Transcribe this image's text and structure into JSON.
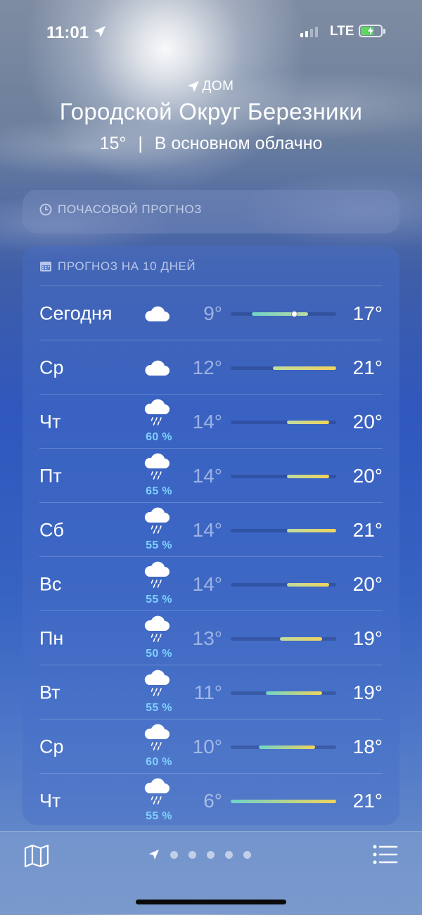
{
  "status_bar": {
    "time": "11:01",
    "network": "LTE",
    "battery_color": "#5fd65f"
  },
  "header": {
    "location_label": "ДОМ",
    "city": "Городской Округ Березники",
    "current_temp": "15°",
    "separator": "|",
    "condition": "В основном облачно"
  },
  "hourly": {
    "title": "ПОЧАСОВОЙ ПРОГНОЗ",
    "icon": "clock-icon"
  },
  "daily": {
    "title": "ПРОГНОЗ НА 10 ДНЕЙ",
    "icon": "calendar-icon",
    "range_min": 6,
    "range_max": 21,
    "current_temp_value": 15,
    "days": [
      {
        "day": "Сегодня",
        "icon": "cloud-icon",
        "precip": "",
        "low": "9°",
        "high": "17°",
        "low_v": 9,
        "high_v": 17,
        "is_today": true
      },
      {
        "day": "Ср",
        "icon": "cloud-icon",
        "precip": "",
        "low": "12°",
        "high": "21°",
        "low_v": 12,
        "high_v": 21
      },
      {
        "day": "Чт",
        "icon": "cloud-rain-icon",
        "precip": "60 %",
        "low": "14°",
        "high": "20°",
        "low_v": 14,
        "high_v": 20
      },
      {
        "day": "Пт",
        "icon": "cloud-rain-icon",
        "precip": "65 %",
        "low": "14°",
        "high": "20°",
        "low_v": 14,
        "high_v": 20
      },
      {
        "day": "Сб",
        "icon": "cloud-rain-icon",
        "precip": "55 %",
        "low": "14°",
        "high": "21°",
        "low_v": 14,
        "high_v": 21
      },
      {
        "day": "Вс",
        "icon": "cloud-rain-icon",
        "precip": "55 %",
        "low": "14°",
        "high": "20°",
        "low_v": 14,
        "high_v": 20
      },
      {
        "day": "Пн",
        "icon": "cloud-rain-icon",
        "precip": "50 %",
        "low": "13°",
        "high": "19°",
        "low_v": 13,
        "high_v": 19
      },
      {
        "day": "Вт",
        "icon": "cloud-rain-icon",
        "precip": "55 %",
        "low": "11°",
        "high": "19°",
        "low_v": 11,
        "high_v": 19
      },
      {
        "day": "Ср",
        "icon": "cloud-rain-icon",
        "precip": "60 %",
        "low": "10°",
        "high": "18°",
        "low_v": 10,
        "high_v": 18
      },
      {
        "day": "Чт",
        "icon": "cloud-rain-icon",
        "precip": "55 %",
        "low": "6°",
        "high": "21°",
        "low_v": 6,
        "high_v": 21
      }
    ]
  },
  "bottom_bar": {
    "map_icon": "map-icon",
    "list_icon": "list-icon",
    "location_icon": "location-arrow-icon",
    "page_count": 5
  },
  "colors": {
    "cold": "#6fd4c9",
    "mild": "#bfdca0",
    "warm": "#f0d35a"
  }
}
